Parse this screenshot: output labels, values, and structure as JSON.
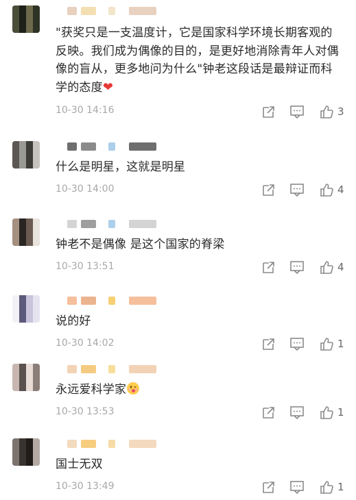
{
  "comments": [
    {
      "text": "\"获奖只是一支温度计，它是国家科学环境长期客观的反映。我们成为偶像的目的，是更好地消除青年人对偶像的盲从，更多地问为什么\"钟老这段话是最辩证而科学的态度",
      "emoji": "heart",
      "time": "10-30 14:16",
      "likes": "3",
      "avatar_colors": [
        "#4a4f3a",
        "#2f3326",
        "#6d6a4c",
        "#1e2119"
      ],
      "name_colors": [
        "#e5c9b5",
        "#f2d9a6",
        "#f0e0c0"
      ]
    },
    {
      "text": "什么是明星，这就是明星",
      "time": "10-30 14:00",
      "likes": "4",
      "avatar_colors": [
        "#9a9a95",
        "#5c5752",
        "#c6c3bd",
        "#3f3d3a"
      ],
      "name_colors": [
        "#555555",
        "#777777",
        "#9ec7e8"
      ]
    },
    {
      "text": "钟老不是偶像 是这个国家的脊梁",
      "time": "10-30 13:51",
      "likes": "4",
      "avatar_colors": [
        "#6b5a52",
        "#2a2522",
        "#a58f80",
        "#e9e3dd"
      ],
      "name_colors": [
        "#cccccc",
        "#8d8d8d",
        "#9ec7e8"
      ]
    },
    {
      "text": "说的好",
      "time": "10-30 14:02",
      "likes": "1",
      "avatar_colors": [
        "#e6e4ef",
        "#c9c4dc",
        "#5b5a7a",
        "#f3f1f6"
      ],
      "name_colors": [
        "#f4b48a",
        "#e9a67b",
        "#f6c75c"
      ]
    },
    {
      "text": "永远爱科学家",
      "emoji": "face",
      "time": "10-30 13:53",
      "likes": "1",
      "avatar_colors": [
        "#c7b7b0",
        "#8b7d78",
        "#e9dcd6",
        "#5b524f"
      ],
      "name_colors": [
        "#f1cba8",
        "#f3c26b",
        "#f7d88a"
      ]
    },
    {
      "text": "国士无双",
      "time": "10-30 13:49",
      "likes": "1",
      "avatar_colors": [
        "#3a3431",
        "#7d746e",
        "#b4aaa3",
        "#1f1c1a"
      ],
      "name_colors": [
        "#f2d3b3",
        "#f6c46a",
        "#f5d596"
      ]
    }
  ],
  "icons": {
    "share": "share-icon",
    "comment": "comment-icon",
    "like": "thumbs-up-icon"
  }
}
